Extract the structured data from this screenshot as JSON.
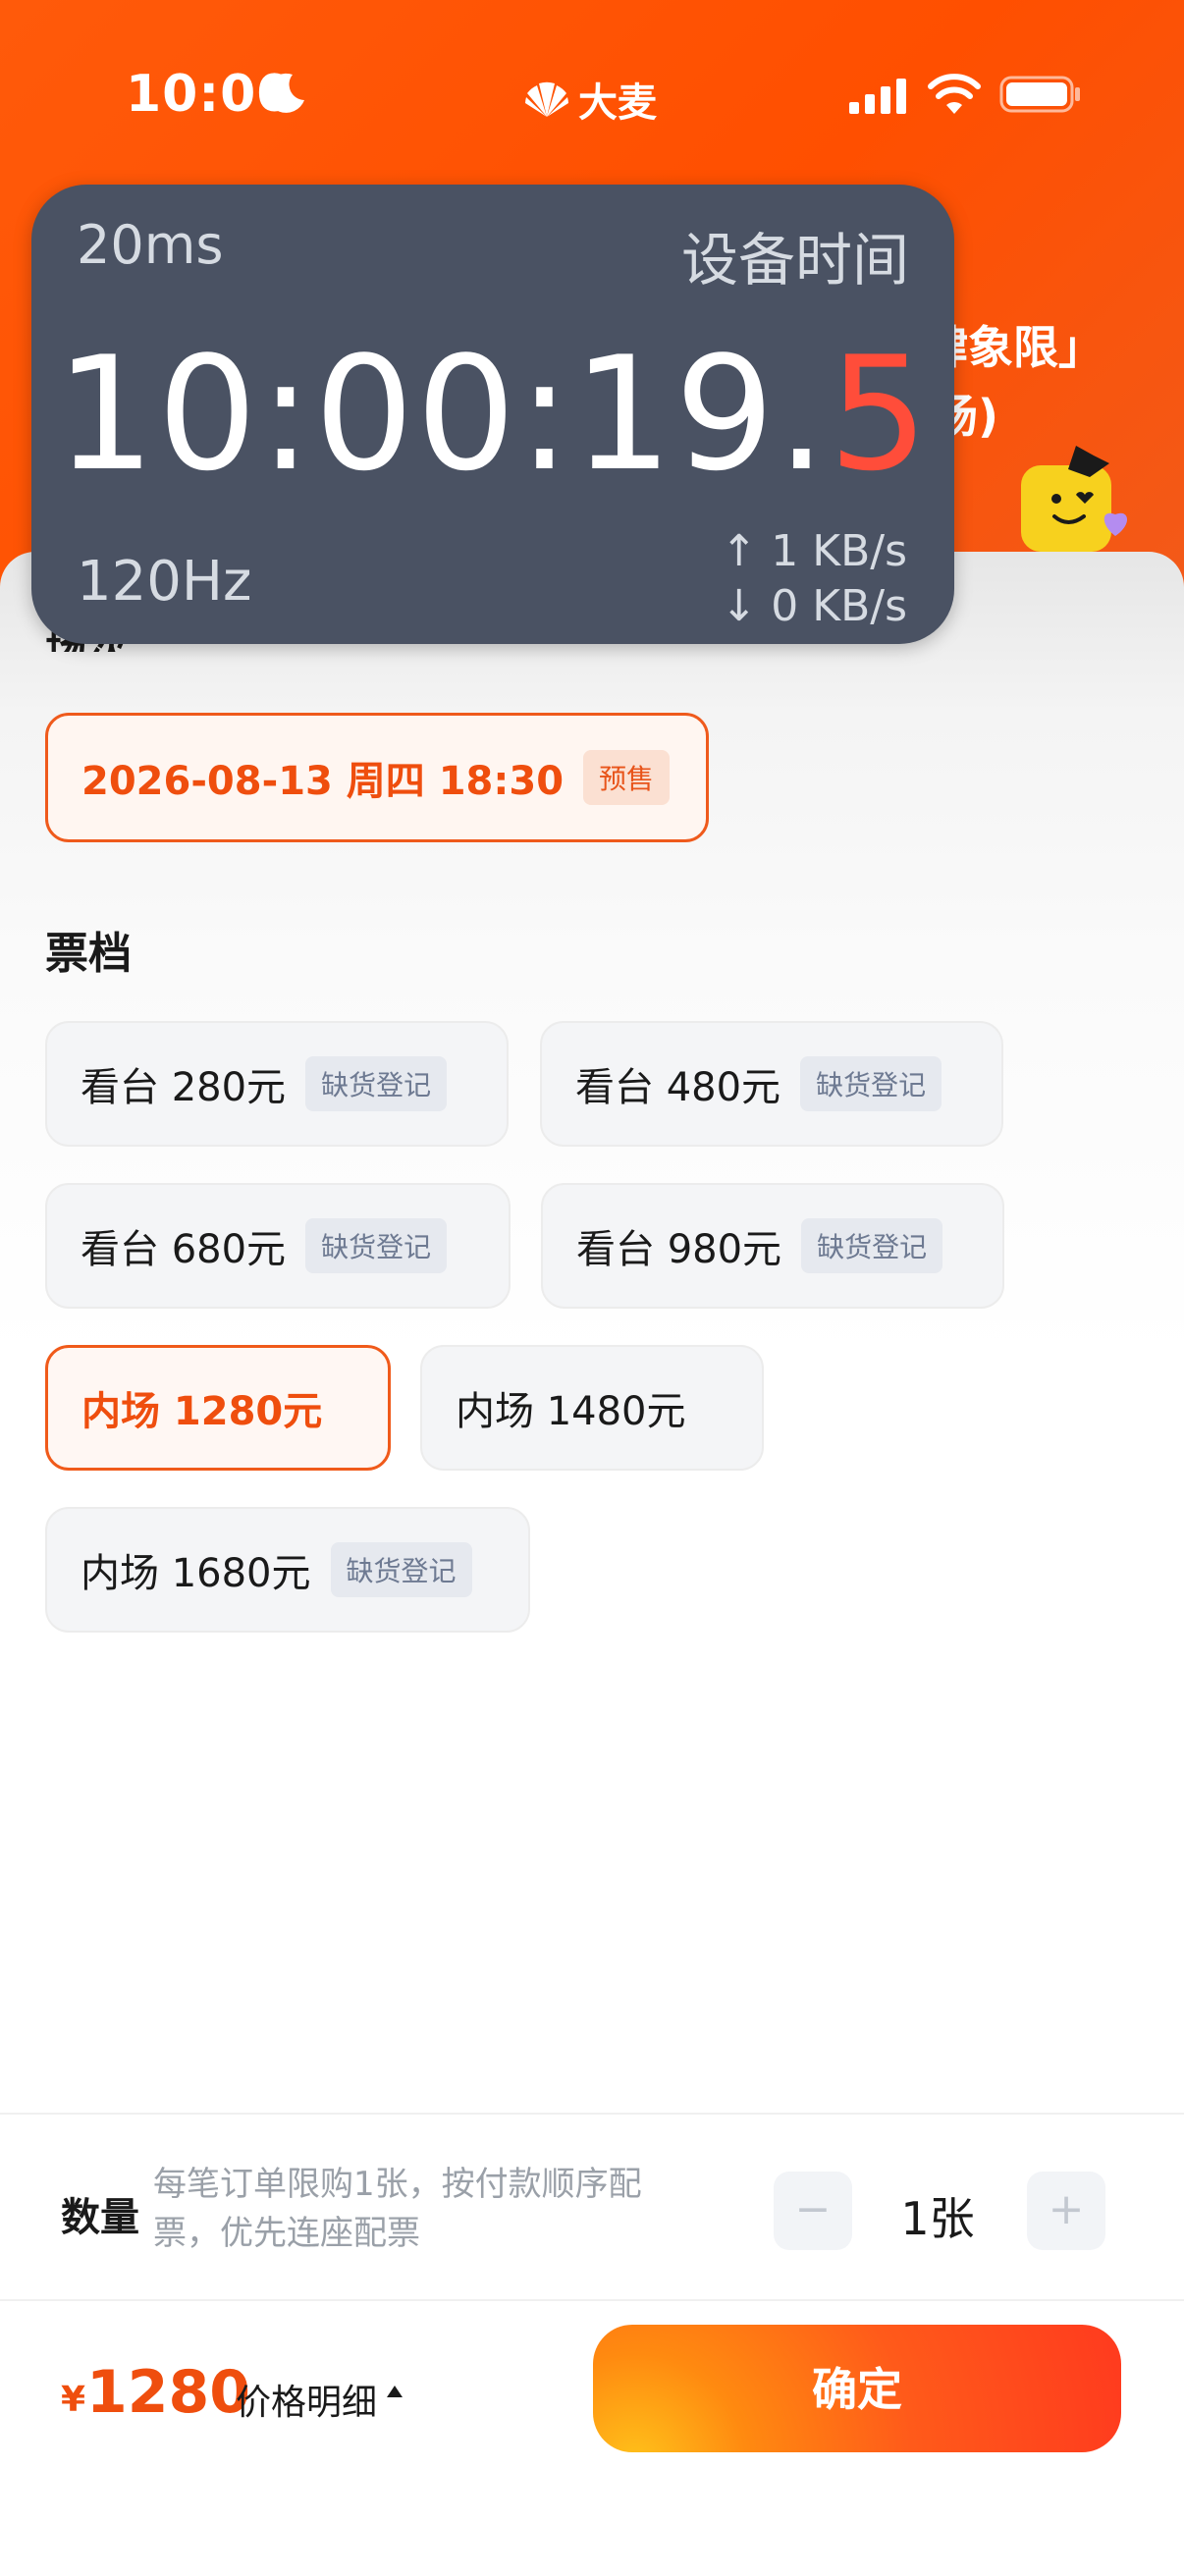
{
  "status_bar": {
    "time": "10:00",
    "app_name": "大麦"
  },
  "header": {
    "title_fragment_1": "肆象限」",
    "title_fragment_2": "场)"
  },
  "overlay": {
    "latency": "20ms",
    "label": "设备时间",
    "clock_main": "10:00:19.",
    "clock_fraction": "5",
    "refresh_rate": "120Hz",
    "upload": "↑ 1 KB/s",
    "download": "↓ 0 KB/s"
  },
  "session": {
    "section_label": "场次",
    "datetime": "2026-08-13 周四 18:30",
    "badge": "预售"
  },
  "tiers": {
    "title": "票档",
    "items": [
      {
        "label": "看台 280元",
        "badge": "缺货登记",
        "selected": false
      },
      {
        "label": "看台 480元",
        "badge": "缺货登记",
        "selected": false
      },
      {
        "label": "看台 680元",
        "badge": "缺货登记",
        "selected": false
      },
      {
        "label": "看台 980元",
        "badge": "缺货登记",
        "selected": false
      },
      {
        "label": "内场 1280元",
        "badge": "",
        "selected": true
      },
      {
        "label": "内场 1480元",
        "badge": "",
        "selected": false
      },
      {
        "label": "内场 1680元",
        "badge": "缺货登记",
        "selected": false
      }
    ]
  },
  "quantity": {
    "label": "数量",
    "note": "每笔订单限购1张，按付款顺序配票，优先连座配票",
    "minus": "−",
    "value": "1张",
    "plus": "+"
  },
  "footer": {
    "currency": "¥",
    "price": "1280",
    "detail_label": "价格明细",
    "confirm_label": "确定"
  },
  "colors": {
    "brand_orange": "#ff5a0a",
    "accent_red_orange": "#ef4e0e",
    "overlay_bg": "#4a5263"
  }
}
